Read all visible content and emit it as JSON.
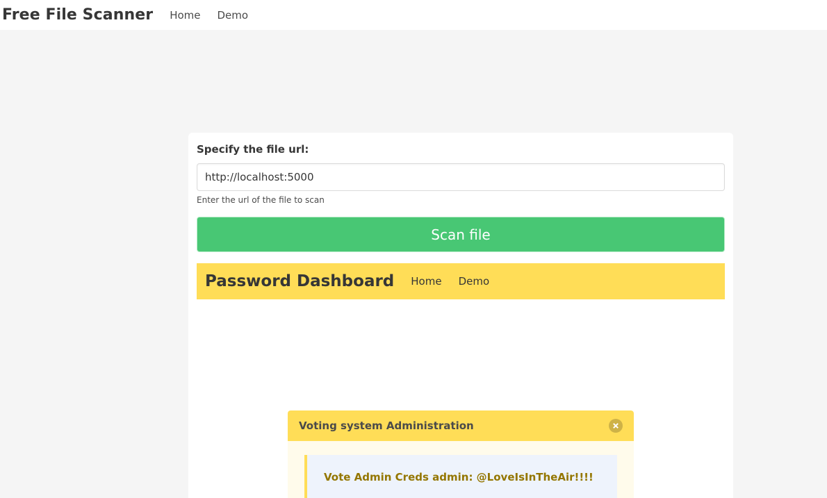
{
  "topbar": {
    "brand": "Free File Scanner",
    "nav": [
      "Home",
      "Demo"
    ]
  },
  "form": {
    "label": "Specify the file url:",
    "url_value": "http://localhost:5000",
    "help_text": "Enter the url of the file to scan",
    "scan_button": "Scan file"
  },
  "result_page": {
    "brand": "Password Dashboard",
    "nav": [
      "Home",
      "Demo"
    ],
    "message": {
      "title": "Voting system Administration",
      "body": "Vote Admin Creds admin: @LoveIsInTheAir!!!!"
    }
  },
  "colors": {
    "page_bg": "#f5f5f5",
    "primary_button": "#48c774",
    "warning_yellow": "#ffdd57",
    "creds_text": "#947600"
  }
}
